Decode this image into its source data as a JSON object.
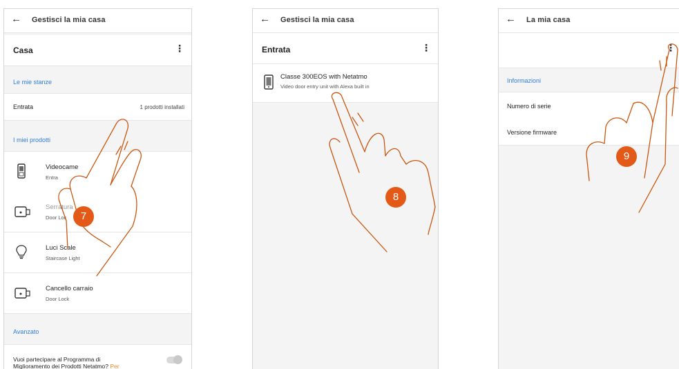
{
  "screen1": {
    "appbar_title": "Gestisci la mia casa",
    "header_name": "Casa",
    "section_rooms": "Le mie stanze",
    "room": {
      "label": "Entrata",
      "value": "1 prodotti installati"
    },
    "section_products": "I miei prodotti",
    "products": [
      {
        "name": "Videocame",
        "sub": "Entra",
        "icon": "video-door-entry-icon"
      },
      {
        "name": "Serratura",
        "sub": "Door Loc",
        "icon": "door-lock-icon"
      },
      {
        "name": "Luci Scale",
        "sub": "Staircase Light",
        "icon": "light-bulb-icon"
      },
      {
        "name": "Cancello carraio",
        "sub": "Door Lock",
        "icon": "door-lock-icon"
      }
    ],
    "section_advanced": "Avanzato",
    "program_text_1": "Vuoi partecipare al Programma di",
    "program_text_2": "Miglioramento dei Prodotti Netatmo?",
    "program_link": "Per",
    "step": "7"
  },
  "screen2": {
    "appbar_title": "Gestisci la mia casa",
    "header_name": "Entrata",
    "product": {
      "name": "Classe 300EOS with Netatmo",
      "sub": "Video door entry unit with Alexa built in",
      "icon": "video-door-entry-icon"
    },
    "step": "8"
  },
  "screen3": {
    "appbar_title": "La mia casa",
    "section_info": "Informazioni",
    "rows": [
      {
        "label": "Numero di serie"
      },
      {
        "label": "Versione firmware"
      }
    ],
    "step": "9"
  },
  "colors": {
    "accent_blue": "#2f7fd9",
    "step_orange": "#e35a18",
    "link_orange": "#f08a2c",
    "hand_stroke": "#c9560f"
  }
}
